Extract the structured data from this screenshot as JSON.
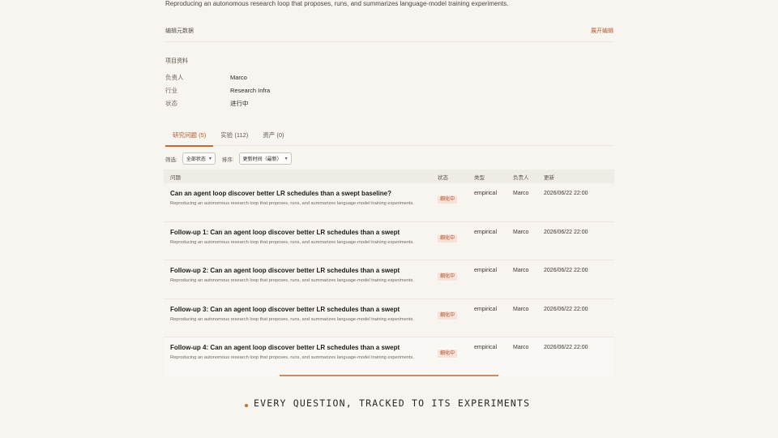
{
  "header": {
    "description": "Reproducing an autonomous research loop that proposes, runs, and summarizes language-model training experiments."
  },
  "meta": {
    "edit_metadata_label": "编辑元数据",
    "expand_edit_label": "展开编辑"
  },
  "profile": {
    "title": "项目资料",
    "fields": [
      {
        "key": "负责人",
        "value": "Marco"
      },
      {
        "key": "行业",
        "value": "Research Infra"
      },
      {
        "key": "状态",
        "value": "进行中"
      }
    ]
  },
  "tabs": [
    {
      "label": "研究问题 (5)",
      "active": true
    },
    {
      "label": "实验 (112)",
      "active": false
    },
    {
      "label": "资产 (0)",
      "active": false
    }
  ],
  "filters": {
    "filter_label": "筛选:",
    "filter_value": "全部状态",
    "sort_label": "排序:",
    "sort_value": "更新时间（最新）"
  },
  "table": {
    "headers": {
      "question": "问题",
      "status": "状态",
      "type": "类型",
      "owner": "负责人",
      "updated": "更新"
    },
    "rows": [
      {
        "title": "Can an agent loop discover better LR schedules than a swept baseline?",
        "desc": "Reproducing an autonomous research loop that proposes, runs, and summarizes language-model training experiments.",
        "status": "细化中",
        "type": "empirical",
        "owner": "Marco",
        "updated": "2026/06/22 22:00"
      },
      {
        "title": "Follow-up 1: Can an agent loop discover better LR schedules than a swept",
        "desc": "Reproducing an autonomous research loop that proposes, runs, and summarizes language-model training experiments.",
        "status": "细化中",
        "type": "empirical",
        "owner": "Marco",
        "updated": "2026/06/22 22:00"
      },
      {
        "title": "Follow-up 2: Can an agent loop discover better LR schedules than a swept",
        "desc": "Reproducing an autonomous research loop that proposes, runs, and summarizes language-model training experiments.",
        "status": "细化中",
        "type": "empirical",
        "owner": "Marco",
        "updated": "2026/06/22 22:00"
      },
      {
        "title": "Follow-up 3: Can an agent loop discover better LR schedules than a swept",
        "desc": "Reproducing an autonomous research loop that proposes, runs, and summarizes language-model training experiments.",
        "status": "细化中",
        "type": "empirical",
        "owner": "Marco",
        "updated": "2026/06/22 22:00"
      },
      {
        "title": "Follow-up 4: Can an agent loop discover better LR schedules than a swept",
        "desc": "Reproducing an autonomous research loop that proposes, runs, and summarizes language-model training experiments.",
        "status": "细化中",
        "type": "empirical",
        "owner": "Marco",
        "updated": "2026/06/22 22:00"
      }
    ]
  },
  "caption": "EVERY QUESTION, TRACKED TO ITS EXPERIMENTS",
  "colors": {
    "accent": "#c06a3c",
    "badge_bg": "#f6e2d8",
    "badge_text": "#b04a26",
    "background": "#f8f5f0"
  }
}
